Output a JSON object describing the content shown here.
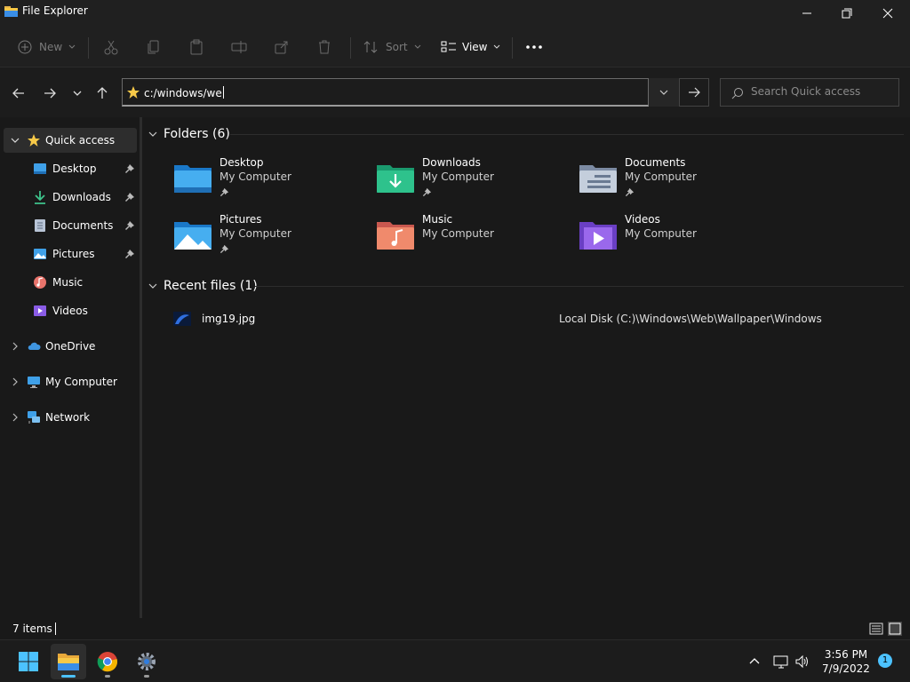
{
  "window": {
    "title": "File Explorer"
  },
  "toolbar": {
    "new_label": "New",
    "sort_label": "Sort",
    "view_label": "View"
  },
  "address": {
    "value": "c:/windows/we",
    "search_placeholder": "Search Quick access"
  },
  "sidebar": {
    "quick_access": "Quick access",
    "items": [
      {
        "label": "Desktop"
      },
      {
        "label": "Downloads"
      },
      {
        "label": "Documents"
      },
      {
        "label": "Pictures"
      },
      {
        "label": "Music"
      },
      {
        "label": "Videos"
      }
    ],
    "onedrive": "OneDrive",
    "my_computer": "My Computer",
    "network": "Network"
  },
  "content": {
    "folders_heading": "Folders (6)",
    "folders": [
      {
        "name": "Desktop",
        "location": "My Computer"
      },
      {
        "name": "Downloads",
        "location": "My Computer"
      },
      {
        "name": "Documents",
        "location": "My Computer"
      },
      {
        "name": "Pictures",
        "location": "My Computer"
      },
      {
        "name": "Music",
        "location": "My Computer"
      },
      {
        "name": "Videos",
        "location": "My Computer"
      }
    ],
    "recent_heading": "Recent files (1)",
    "recent_files": [
      {
        "name": "img19.jpg",
        "path": "Local Disk (C:)\\Windows\\Web\\Wallpaper\\Windows"
      }
    ]
  },
  "status": {
    "items_count": "7 items"
  },
  "taskbar": {
    "time": "3:56 PM",
    "date": "7/9/2022",
    "notification_count": "1"
  },
  "colors": {
    "accent": "#4cc2ff",
    "background": "#191919",
    "toolbar": "#202020",
    "folder_star": "#f7c948"
  }
}
